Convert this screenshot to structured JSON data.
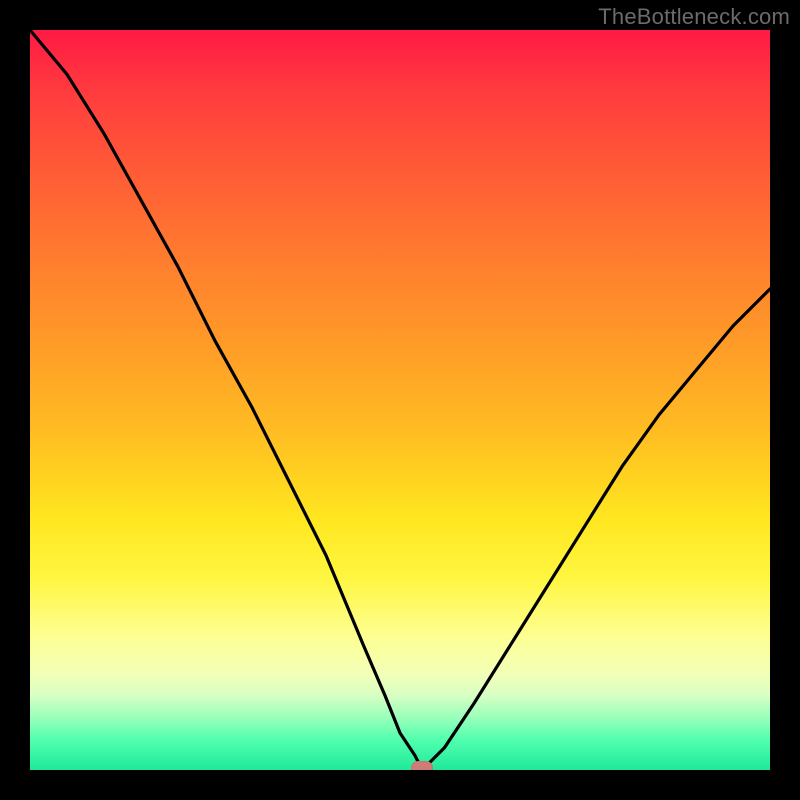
{
  "watermark": "TheBottleneck.com",
  "colors": {
    "frame": "#000000",
    "curve": "#000000",
    "marker": "#cf7b76"
  },
  "chart_data": {
    "type": "line",
    "title": "",
    "xlabel": "",
    "ylabel": "",
    "xlim": [
      0,
      100
    ],
    "ylim": [
      0,
      100
    ],
    "grid": false,
    "legend": false,
    "curve_note": "V-shaped bottleneck curve. Values are approximate bottleneck percentage vs. a normalized x position (0–100). Minimum near x≈53.",
    "x": [
      0,
      5,
      10,
      15,
      20,
      25,
      30,
      35,
      40,
      45,
      48,
      50,
      52,
      53,
      54,
      56,
      60,
      65,
      70,
      75,
      80,
      85,
      90,
      95,
      100
    ],
    "values": [
      100,
      94,
      86,
      77,
      68,
      58,
      49,
      39,
      29,
      17,
      10,
      5,
      2,
      0,
      1,
      3,
      9,
      17,
      25,
      33,
      41,
      48,
      54,
      60,
      65
    ],
    "marker": {
      "x": 53,
      "y": 0
    },
    "background_gradient": {
      "axis": "y",
      "stops": [
        {
          "pos": 0,
          "color": "#ff1a44"
        },
        {
          "pos": 30,
          "color": "#ff7a2f"
        },
        {
          "pos": 55,
          "color": "#ffbf22"
        },
        {
          "pos": 74,
          "color": "#fff640"
        },
        {
          "pos": 90,
          "color": "#d6ffc3"
        },
        {
          "pos": 100,
          "color": "#20e89a"
        }
      ]
    }
  }
}
